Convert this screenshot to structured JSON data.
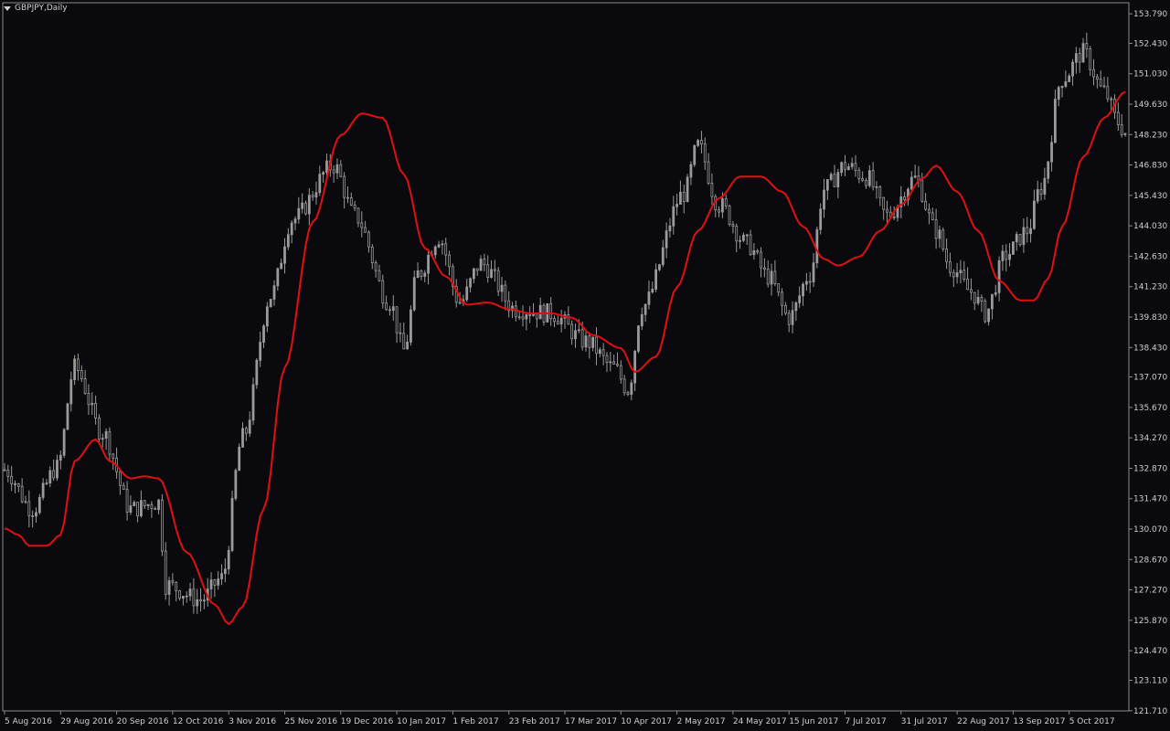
{
  "window": {
    "symbol_title": "GBPJPY,Daily"
  },
  "colors": {
    "background": "#0a0a0e",
    "frame": "#8a8a8a",
    "candle": "#9a9a9a",
    "ma": "#e01010",
    "text": "#cfcfcf"
  },
  "chart_data": {
    "type": "candlestick",
    "title": "GBPJPY,Daily",
    "ylim": [
      121.7,
      154.3
    ],
    "y_ticks": [
      153.79,
      152.43,
      151.03,
      149.63,
      148.23,
      146.83,
      145.43,
      144.03,
      142.63,
      141.23,
      139.83,
      138.43,
      137.07,
      135.67,
      134.27,
      132.87,
      131.47,
      130.07,
      128.67,
      127.27,
      125.87,
      124.47,
      123.11,
      121.71
    ],
    "y_tick_labels": [
      "153.790",
      "152.430",
      "151.030",
      "149.630",
      "148.230",
      "146.830",
      "145.430",
      "144.030",
      "142.630",
      "141.230",
      "139.830",
      "138.430",
      "137.070",
      "135.670",
      "134.270",
      "132.870",
      "131.470",
      "130.070",
      "128.670",
      "127.270",
      "125.870",
      "124.470",
      "123.110",
      "121.710"
    ],
    "x_labels": [
      {
        "label": "5 Aug 2016",
        "index": 0
      },
      {
        "label": "29 Aug 2016",
        "index": 16
      },
      {
        "label": "20 Sep 2016",
        "index": 32
      },
      {
        "label": "12 Oct 2016",
        "index": 48
      },
      {
        "label": "3 Nov 2016",
        "index": 64
      },
      {
        "label": "25 Nov 2016",
        "index": 80
      },
      {
        "label": "19 Dec 2016",
        "index": 96
      },
      {
        "label": "10 Jan 2017",
        "index": 112
      },
      {
        "label": "1 Feb 2017",
        "index": 128
      },
      {
        "label": "23 Feb 2017",
        "index": 144
      },
      {
        "label": "17 Mar 2017",
        "index": 160
      },
      {
        "label": "10 Apr 2017",
        "index": 176
      },
      {
        "label": "2 May 2017",
        "index": 192
      },
      {
        "label": "24 May 2017",
        "index": 208
      },
      {
        "label": "15 Jun 2017",
        "index": 224
      },
      {
        "label": "7 Jul 2017",
        "index": 240
      },
      {
        "label": "31 Jul 2017",
        "index": 256
      },
      {
        "label": "22 Aug 2017",
        "index": 272
      },
      {
        "label": "13 Sep 2017",
        "index": 288
      },
      {
        "label": "5 Oct 2017",
        "index": 304
      }
    ],
    "close_keypoints": [
      [
        0,
        132.8
      ],
      [
        8,
        131.0
      ],
      [
        15,
        132.9
      ],
      [
        20,
        137.5
      ],
      [
        28,
        134.5
      ],
      [
        36,
        131.0
      ],
      [
        44,
        131.3
      ],
      [
        46,
        127.5
      ],
      [
        56,
        126.8
      ],
      [
        62,
        127.8
      ],
      [
        68,
        134.3
      ],
      [
        76,
        140.8
      ],
      [
        82,
        144.3
      ],
      [
        94,
        146.8
      ],
      [
        100,
        144.5
      ],
      [
        110,
        140.5
      ],
      [
        114,
        138.3
      ],
      [
        118,
        141.8
      ],
      [
        124,
        143.5
      ],
      [
        130,
        140.5
      ],
      [
        136,
        142.3
      ],
      [
        146,
        140.2
      ],
      [
        156,
        140.0
      ],
      [
        166,
        138.7
      ],
      [
        174,
        137.5
      ],
      [
        178,
        136.5
      ],
      [
        182,
        140.3
      ],
      [
        194,
        145.5
      ],
      [
        198,
        147.7
      ],
      [
        204,
        145.0
      ],
      [
        212,
        143.2
      ],
      [
        218,
        141.7
      ],
      [
        224,
        139.8
      ],
      [
        230,
        141.8
      ],
      [
        234,
        145.7
      ],
      [
        240,
        146.8
      ],
      [
        246,
        146.3
      ],
      [
        252,
        144.5
      ],
      [
        260,
        146.2
      ],
      [
        266,
        143.8
      ],
      [
        270,
        142.2
      ],
      [
        276,
        141.0
      ],
      [
        280,
        140.0
      ],
      [
        286,
        142.7
      ],
      [
        292,
        143.8
      ],
      [
        296,
        145.8
      ],
      [
        302,
        150.8
      ],
      [
        308,
        152.0
      ],
      [
        314,
        150.2
      ],
      [
        318,
        148.8
      ],
      [
        320,
        148.3
      ]
    ],
    "ma_keypoints": [
      [
        0,
        130.1
      ],
      [
        4,
        129.8
      ],
      [
        7,
        129.3
      ],
      [
        12,
        129.3
      ],
      [
        16,
        129.8
      ],
      [
        20,
        133.2
      ],
      [
        26,
        134.2
      ],
      [
        30,
        133.2
      ],
      [
        36,
        132.4
      ],
      [
        40,
        132.5
      ],
      [
        44,
        132.4
      ],
      [
        52,
        129.0
      ],
      [
        60,
        126.6
      ],
      [
        64,
        125.7
      ],
      [
        68,
        126.5
      ],
      [
        74,
        131.0
      ],
      [
        80,
        137.5
      ],
      [
        88,
        144.2
      ],
      [
        96,
        148.2
      ],
      [
        102,
        149.2
      ],
      [
        108,
        149.0
      ],
      [
        114,
        146.4
      ],
      [
        120,
        143.0
      ],
      [
        126,
        141.7
      ],
      [
        132,
        140.4
      ],
      [
        138,
        140.5
      ],
      [
        144,
        140.2
      ],
      [
        150,
        140.0
      ],
      [
        156,
        140.0
      ],
      [
        162,
        139.8
      ],
      [
        168,
        139.0
      ],
      [
        176,
        138.4
      ],
      [
        180,
        137.3
      ],
      [
        186,
        138.0
      ],
      [
        192,
        141.2
      ],
      [
        198,
        143.8
      ],
      [
        204,
        145.3
      ],
      [
        210,
        146.3
      ],
      [
        216,
        146.3
      ],
      [
        222,
        145.6
      ],
      [
        228,
        144.0
      ],
      [
        234,
        142.5
      ],
      [
        238,
        142.2
      ],
      [
        244,
        142.6
      ],
      [
        250,
        143.8
      ],
      [
        256,
        145.0
      ],
      [
        262,
        146.2
      ],
      [
        266,
        146.8
      ],
      [
        272,
        145.6
      ],
      [
        278,
        143.8
      ],
      [
        284,
        141.5
      ],
      [
        290,
        140.6
      ],
      [
        294,
        140.6
      ],
      [
        298,
        141.6
      ],
      [
        302,
        144.0
      ],
      [
        308,
        147.2
      ],
      [
        314,
        149.0
      ],
      [
        320,
        150.2
      ]
    ],
    "ma_period": 20,
    "volatility": 0.55,
    "grid": false
  }
}
